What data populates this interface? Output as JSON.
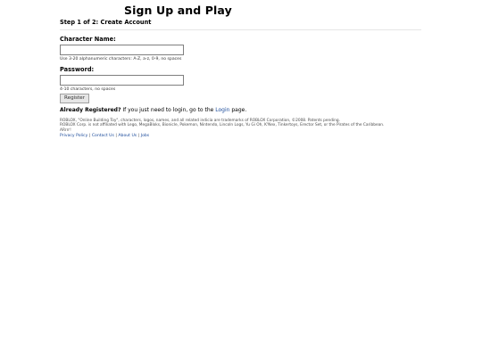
{
  "page": {
    "title": "Sign Up and Play",
    "step": "Step 1 of 2: Create Account"
  },
  "form": {
    "character_name_label": "Character Name:",
    "character_name_value": "",
    "character_name_hint": "Use 3-20 alphanumeric characters: A-Z, a-z, 0-9, no spaces",
    "password_label": "Password:",
    "password_value": "",
    "password_hint": "4-10 characters, no spaces",
    "register_button": "Register"
  },
  "already_registered": {
    "prefix": "Already Registered?",
    "text_before": " If you just need to login, go to the ",
    "link": "Login",
    "text_after": " page."
  },
  "legal": {
    "line1": "ROBLOX, \"Online Building Toy\", characters, logos, names, and all related indicia are trademarks of ROBLOX Corporation, ©2008. Patents pending.",
    "line2": "ROBLOX Corp. is not affiliated with Lego, MegaBloks, Bionicle, Pokemon, Nintendo, Lincoln Logs, Yu Gi Oh, K'Nex, Tinkertoys, Erector Set, or the Pirates of the Caribbean.",
    "line3": "ARrrr!"
  },
  "footer": {
    "links": [
      "Privacy Policy",
      "Contact Us",
      "About Us",
      "Jobs"
    ],
    "separator": "|"
  },
  "colors": {
    "link": "#1a4a9a",
    "button_bg": "#e6e6e6"
  }
}
